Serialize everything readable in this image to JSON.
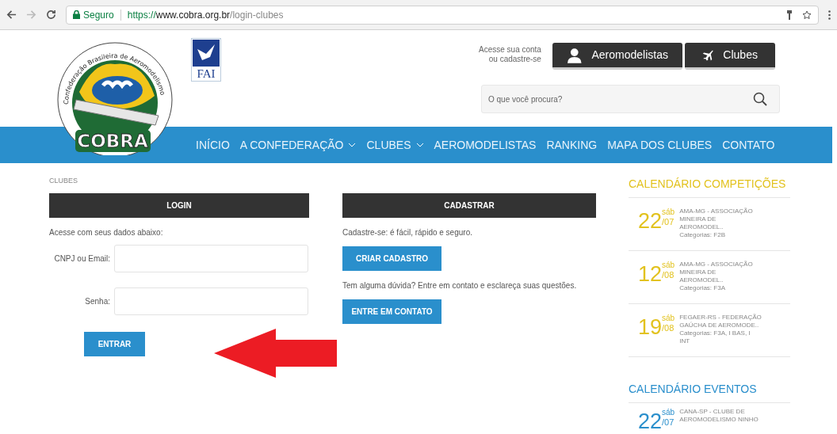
{
  "browser": {
    "security_label": "Seguro",
    "url_scheme": "https://",
    "url_host": "www.cobra.org.br",
    "url_path": "/login-clubes"
  },
  "header": {
    "logo_ring_text": "Confederação Brasileira de Aeromodelismo",
    "logo_name": "COBRA",
    "fai_label": "FAI",
    "account_prompt": [
      "Acesse sua conta",
      "ou cadastre-se"
    ],
    "account_buttons": [
      {
        "kind": "person",
        "label": "Aeromodelistas"
      },
      {
        "kind": "plane",
        "label": "Clubes"
      }
    ],
    "search": {
      "placeholder": "O que você procura?"
    }
  },
  "nav": [
    {
      "label": "INÍCIO",
      "dropdown": false
    },
    {
      "label": "A CONFEDERAÇÃO",
      "dropdown": true
    },
    {
      "label": "CLUBES",
      "dropdown": true
    },
    {
      "label": "AEROMODELISTAS",
      "dropdown": false
    },
    {
      "label": "RANKING",
      "dropdown": false
    },
    {
      "label": "MAPA DOS CLUBES",
      "dropdown": false
    },
    {
      "label": "CONTATO",
      "dropdown": false
    }
  ],
  "breadcrumb": "CLUBES",
  "login": {
    "title": "LOGIN",
    "intro": "Acesse com seus dados abaixo:",
    "fields": [
      {
        "label": "CNPJ ou Email:"
      },
      {
        "label": "Senha:"
      }
    ],
    "submit": "ENTRAR"
  },
  "register": {
    "title": "CADASTRAR",
    "intro": "Cadastre-se: é fácil, rápido e seguro.",
    "create_button": "CRIAR CADASTRO",
    "help_text": "Tem alguma dúvida? Entre em contato e esclareça suas questões.",
    "contact_button": "ENTRE EM CONTATO"
  },
  "calendars": [
    {
      "title": "CALENDÁRIO COMPETIÇÕES",
      "color": "#e2c21e",
      "events": [
        {
          "day": "22",
          "weekday": "sáb",
          "month": "/07",
          "lines": [
            "AMA-MG - ASSOCIAÇÃO",
            "MINEIRA DE",
            "AEROMODEL..",
            "Categorias: F2B"
          ]
        },
        {
          "day": "12",
          "weekday": "sáb",
          "month": "/08",
          "lines": [
            "AMA-MG - ASSOCIAÇÃO",
            "MINEIRA DE",
            "AEROMODEL..",
            "Categorias: F3A"
          ]
        },
        {
          "day": "19",
          "weekday": "sáb",
          "month": "/08",
          "lines": [
            "FEGAER-RS - FEDERAÇÃO",
            "GAÚCHA DE AEROMODE..",
            "Categorias: F3A, I BAS, I",
            "INT"
          ]
        }
      ]
    },
    {
      "title": "CALENDÁRIO EVENTOS",
      "color": "#2a8fcc",
      "events": [
        {
          "day": "22",
          "weekday": "sáb",
          "month": "/07",
          "lines": [
            "CANA-SP - CLUBE DE",
            "AEROMODELISMO NINHO"
          ]
        }
      ]
    }
  ]
}
